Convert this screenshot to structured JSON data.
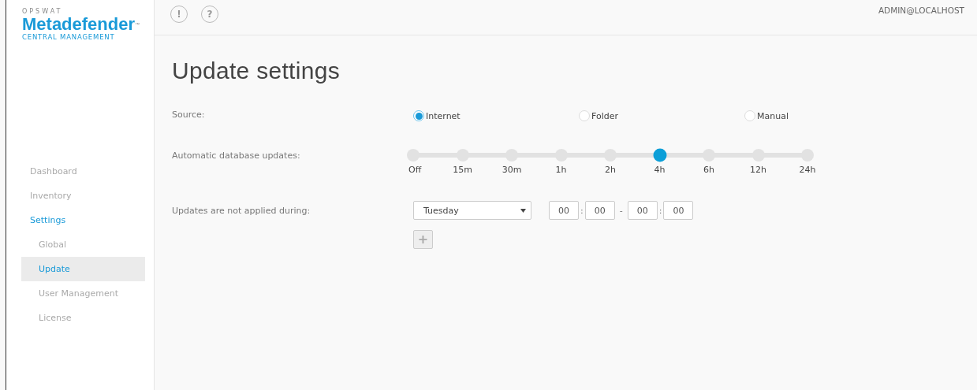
{
  "logo": {
    "brand": "OPSWAT",
    "product": "Metadefender",
    "trademark": "™",
    "subtitle": "CENTRAL MANAGEMENT"
  },
  "header": {
    "icons": [
      "!",
      "?"
    ],
    "user": "ADMIN@LOCALHOST"
  },
  "sidebar": {
    "items": [
      {
        "label": "Dashboard",
        "selected": false
      },
      {
        "label": "Inventory",
        "selected": false
      },
      {
        "label": "Settings",
        "selected": true,
        "children": [
          {
            "label": "Global",
            "selected": false
          },
          {
            "label": "Update",
            "selected": true
          },
          {
            "label": "User Management",
            "selected": false
          },
          {
            "label": "License",
            "selected": false
          }
        ]
      }
    ]
  },
  "title": "Update settings",
  "source": {
    "label": "Source:",
    "options": [
      {
        "label": "Internet",
        "selected": true
      },
      {
        "label": "Folder",
        "selected": false
      },
      {
        "label": "Manual",
        "selected": false
      }
    ]
  },
  "updates": {
    "label": "Automatic database updates:",
    "level": 0.625,
    "stops": [
      "Off",
      "15m",
      "30m",
      "1h",
      "2h",
      "4h",
      "6h",
      "12h",
      "24h"
    ]
  },
  "blackout": {
    "label": "Updates are not applied during:",
    "day": "Tuesday",
    "from_hour": "00",
    "from_sep": ":",
    "from_minute": "00",
    "range_sep": "-",
    "to_hour": "00",
    "to_sep": ":",
    "to_minute": "00",
    "add": "+"
  }
}
